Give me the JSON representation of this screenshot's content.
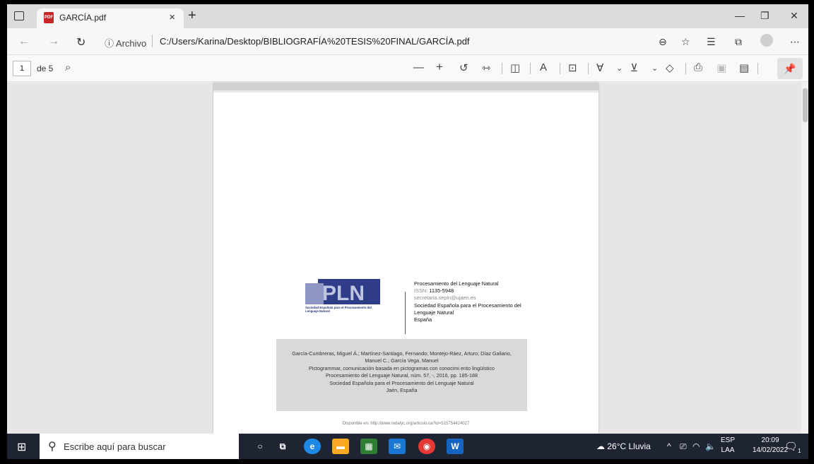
{
  "window": {
    "tab_title": "GARCÍA.pdf",
    "tab_close": "×",
    "new_tab": "+",
    "pdf_badge": "PDF",
    "minimize": "—",
    "restore": "❐",
    "close": "✕"
  },
  "addressbar": {
    "back": "←",
    "forward": "→",
    "refresh": "↻",
    "info": "ⓘ Archivo",
    "url": "C:/Users/Karina/Desktop/BIBLIOGRAFÍA%20TESIS%20FINAL/GARCÍA.pdf",
    "icons": [
      "zoom-out-icon",
      "favorite-icon",
      "favorites-list-icon",
      "collections-icon",
      "profile-icon",
      "menu-icon"
    ]
  },
  "pdf_toolbar": {
    "page_input": "1",
    "page_count": "de 5",
    "search": "⌕",
    "zoom_out": "—",
    "zoom_in": "+",
    "tools": [
      "rotate-icon",
      "fit-width-icon",
      "page-view-icon",
      "read-aloud-icon",
      "text-icon",
      "draw-icon",
      "highlight-icon",
      "eraser-icon",
      "print-icon",
      "save-icon",
      "save-as-icon"
    ],
    "pin": "📌"
  },
  "pdf_page": {
    "logo_text": "Sociedad Española para el Procesamiento del Lenguaje Natural",
    "journal_name": "Procesamiento del Lenguaje Natural",
    "issn_label": "ISSN:",
    "issn": "1135-5948",
    "email": "secretaria.sepln@ujaen.es",
    "publisher": "Sociedad Española para el Procesamiento del Lenguaje Natural",
    "country": "España",
    "citation": [
      "García-Cumbreras, Miguel Á.; Martínez-Santiago, Fernando; Montejo-Ráez, Arturo; Díaz Galiano, Manuel C.; García Vega, Manuel",
      "Pictogrammar, comunicación basada en pictogramas con conocimi ento lingüístico",
      "Procesamiento del Lenguaje Natural, núm. 57, -, 2016, pp. 185-188",
      "Sociedad Española para el Procesamiento del Lenguaje Natural",
      "Jaén, España"
    ],
    "available": "Disponible en: http://www.redalyc.org/articulo.oa?id=515754424027"
  },
  "taskbar": {
    "search_placeholder": "Escribe aquí para buscar",
    "weather": "26°C  Lluvia",
    "lang_top": "ESP",
    "lang_bottom": "LAA",
    "time": "20:09",
    "date": "14/02/2022",
    "notification_count": "1"
  },
  "colors": {
    "pdf_red": "#c62828",
    "logo_blue": "#27357a",
    "taskbar_bg": "#1f2433"
  }
}
